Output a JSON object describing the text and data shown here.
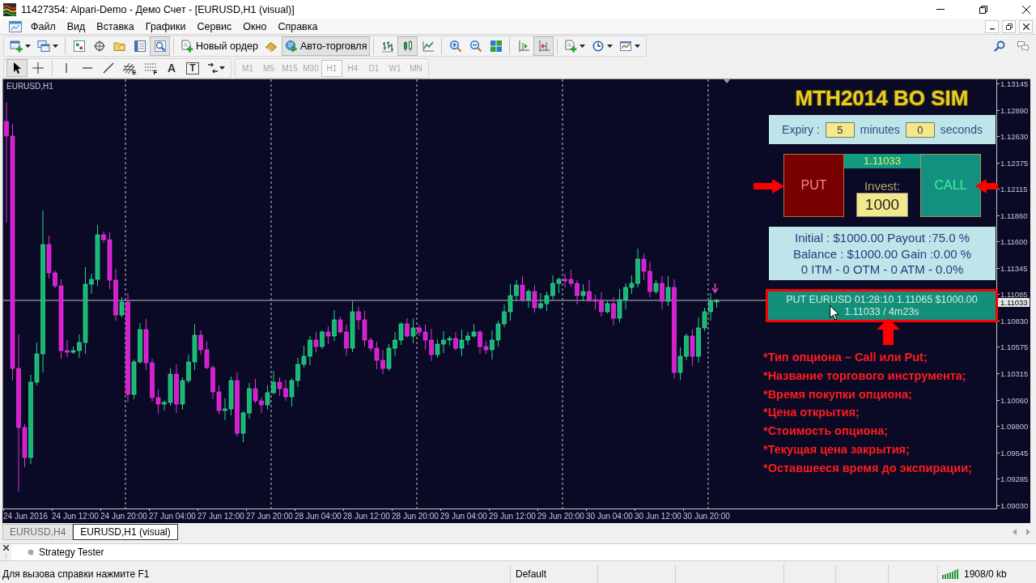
{
  "window": {
    "title": "11427354: Alpari-Demo - Демо Счет - [EURUSD,H1 (visual)]"
  },
  "menu": {
    "items": [
      "Файл",
      "Вид",
      "Вставка",
      "Графики",
      "Сервис",
      "Окно",
      "Справка"
    ]
  },
  "toolbar": {
    "groups": [
      [
        {
          "kind": "icon",
          "pressed": false,
          "dropdown": true
        },
        {
          "kind": "icon",
          "pressed": false,
          "dropdown": true
        }
      ],
      [
        {
          "kind": "icon",
          "pressed": false
        },
        {
          "kind": "icon",
          "pressed": false
        },
        {
          "kind": "icon",
          "pressed": false
        },
        {
          "kind": "icon",
          "pressed": false
        },
        {
          "kind": "icon",
          "pressed": true
        }
      ],
      [
        {
          "kind": "text",
          "label": "Новый ордер",
          "pressed": false
        },
        {
          "kind": "icon",
          "pressed": false
        },
        {
          "kind": "text",
          "label": "Авто-торговля",
          "pressed": true
        }
      ],
      [
        {
          "kind": "icon",
          "pressed": false
        },
        {
          "kind": "icon",
          "pressed": true
        },
        {
          "kind": "icon",
          "pressed": false
        }
      ],
      [
        {
          "kind": "icon",
          "pressed": false
        },
        {
          "kind": "icon",
          "pressed": false
        },
        {
          "kind": "icon",
          "pressed": false
        }
      ],
      [
        {
          "kind": "icon",
          "pressed": false
        },
        {
          "kind": "icon",
          "pressed": true
        }
      ],
      [
        {
          "kind": "icon",
          "pressed": false,
          "dropdown": true
        },
        {
          "kind": "icon",
          "pressed": false,
          "dropdown": true
        },
        {
          "kind": "icon",
          "pressed": false,
          "dropdown": true
        }
      ]
    ]
  },
  "drawing_tools": {
    "groups": [
      [
        {
          "kind": "icon",
          "selected": true
        },
        {
          "kind": "icon",
          "selected": false
        }
      ],
      [
        {
          "kind": "icon",
          "selected": false
        },
        {
          "kind": "icon",
          "selected": false
        },
        {
          "kind": "icon",
          "selected": false
        },
        {
          "kind": "icon",
          "selected": false,
          "subscript": "E"
        },
        {
          "kind": "icon",
          "selected": false,
          "subscript": "F"
        },
        {
          "kind": "letter",
          "label": "A",
          "selected": false
        },
        {
          "kind": "boxed-letter",
          "label": "T",
          "selected": false
        },
        {
          "kind": "icon",
          "selected": false,
          "dropdown": true
        }
      ]
    ]
  },
  "periods": [
    {
      "label": "M1",
      "selected": false,
      "disabled": true
    },
    {
      "label": "M5",
      "selected": false,
      "disabled": true
    },
    {
      "label": "M15",
      "selected": false,
      "disabled": true
    },
    {
      "label": "M30",
      "selected": false,
      "disabled": true
    },
    {
      "label": "H1",
      "selected": true,
      "disabled": true
    },
    {
      "label": "H4",
      "selected": false,
      "disabled": true
    },
    {
      "label": "D1",
      "selected": false,
      "disabled": true
    },
    {
      "label": "W1",
      "selected": false,
      "disabled": true
    },
    {
      "label": "MN",
      "selected": false,
      "disabled": true
    }
  ],
  "chart": {
    "symbol": "EURUSD,H1",
    "price_labels": [
      "1.13145",
      "1.12890",
      "1.12630",
      "1.12375",
      "1.12115",
      "1.11860",
      "1.11600",
      "1.11345",
      "1.11085",
      "1.10830",
      "1.10575",
      "1.10315",
      "1.10060",
      "1.09800",
      "1.09545",
      "1.09285",
      "1.09030"
    ],
    "current_price": "1.11033",
    "time_labels": [
      "24 Jun 2016",
      "24 Jun 12:00",
      "24 Jun 20:00",
      "27 Jun 04:00",
      "27 Jun 12:00",
      "27 Jun 20:00",
      "28 Jun 04:00",
      "28 Jun 12:00",
      "28 Jun 20:00",
      "29 Jun 04:00",
      "29 Jun 12:00",
      "29 Jun 20:00",
      "30 Jun 04:00",
      "30 Jun 12:00",
      "30 Jun 20:00"
    ]
  },
  "bo_panel": {
    "title": "MTH2014 BO SIM",
    "expiry_label": "Expiry :",
    "minutes": "5",
    "minutes_label": "minutes",
    "seconds": "0",
    "seconds_label": "seconds",
    "price": "1.11033",
    "put": "PUT",
    "call": "CALL",
    "invest_label": "Invest:",
    "invest": "1000",
    "stats": [
      "Initial : $1000.00 Payout :75.0 %",
      "Balance : $1000.00 Gain :0.00 %",
      "0 ITM - 0 OTM - 0 ATM - 0.0%"
    ],
    "order": {
      "details": "PUT EURUSD 01:28:10 1.11065 $1000.00",
      "status": "1.11033 / 4m23s"
    }
  },
  "notes": [
    "*Тип опциона – Call или Put;",
    "*Название торгового инструмента;",
    "*Время покупки опциона;",
    "*Цена открытия;",
    "*Стоимость опциона;",
    "*Текущая цена закрытия;",
    "*Оставшееся время до экспирации;"
  ],
  "chart_tabs": [
    {
      "label": "EURUSD,H4",
      "selected": false
    },
    {
      "label": "EURUSD,H1 (visual)",
      "selected": true
    }
  ],
  "tester_panel": {
    "title": "Strategy Tester"
  },
  "status_bar": {
    "help": "Для вызова справки нажмите F1",
    "profile": "Default",
    "traffic": "1908/0 kb"
  }
}
